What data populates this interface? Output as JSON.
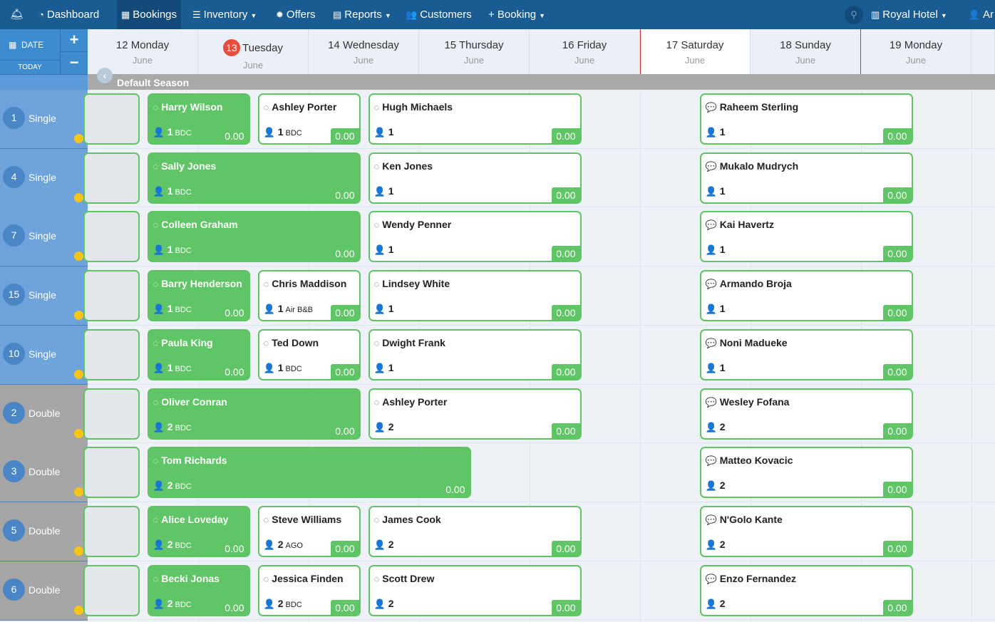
{
  "nav": {
    "items": [
      {
        "label": "Dashboard",
        "icon": "dashboard-icon"
      },
      {
        "label": "Bookings",
        "icon": "grid-icon",
        "active": true
      },
      {
        "label": "Inventory",
        "icon": "database-icon",
        "caret": true
      },
      {
        "label": "Offers",
        "icon": "badge-icon"
      },
      {
        "label": "Reports",
        "icon": "file-icon",
        "caret": true
      },
      {
        "label": "Customers",
        "icon": "users-icon"
      },
      {
        "label": "+ Booking",
        "caret": true
      }
    ],
    "hotel": "Royal Hotel",
    "user": "Ar"
  },
  "controls": {
    "date": "DATE",
    "today": "TODAY",
    "plus": "+",
    "minus": "−"
  },
  "days": [
    {
      "day": "12 Monday",
      "month": "June"
    },
    {
      "day": "Tuesday",
      "month": "June",
      "badge": "13"
    },
    {
      "day": "14 Wednesday",
      "month": "June"
    },
    {
      "day": "15 Thursday",
      "month": "June"
    },
    {
      "day": "16 Friday",
      "month": "June"
    },
    {
      "day": "17 Saturday",
      "month": "June",
      "white": true
    },
    {
      "day": "18 Sunday",
      "month": "June"
    },
    {
      "day": "19 Monday",
      "month": "June"
    },
    {
      "day": "",
      "month": ""
    }
  ],
  "season": "Default Season",
  "rooms": [
    {
      "num": "1",
      "type": "Single",
      "kind": "single"
    },
    {
      "num": "4",
      "type": "Single",
      "kind": "single"
    },
    {
      "num": "7",
      "type": "Single",
      "kind": "single"
    },
    {
      "num": "15",
      "type": "Single",
      "kind": "single"
    },
    {
      "num": "10",
      "type": "Single",
      "kind": "single"
    },
    {
      "num": "2",
      "type": "Double",
      "kind": "double"
    },
    {
      "num": "3",
      "type": "Double",
      "kind": "double"
    },
    {
      "num": "5",
      "type": "Double",
      "kind": "double"
    },
    {
      "num": "6",
      "type": "Double",
      "kind": "double"
    }
  ],
  "bookings": [
    {
      "row": 0,
      "start": -1,
      "end": 0.5,
      "style": "blank"
    },
    {
      "row": 0,
      "start": 0.5,
      "end": 1.5,
      "style": "filled",
      "name": "Harry Wilson",
      "guests": "1",
      "source": "BDC",
      "price": "0.00"
    },
    {
      "row": 0,
      "start": 1.5,
      "end": 2.5,
      "style": "white",
      "name": "Ashley Porter",
      "guests": "1",
      "source": "BDC",
      "price": "0.00"
    },
    {
      "row": 0,
      "start": 2.5,
      "end": 4.5,
      "style": "white",
      "name": "Hugh Michaels",
      "guests": "1",
      "source": "",
      "price": "0.00"
    },
    {
      "row": 0,
      "start": 5.5,
      "end": 7.5,
      "style": "white",
      "multi": true,
      "name": "Raheem Sterling",
      "guests": "1",
      "source": "",
      "price": "0.00"
    },
    {
      "row": 1,
      "start": -1,
      "end": 0.5,
      "style": "blank"
    },
    {
      "row": 1,
      "start": 0.5,
      "end": 2.5,
      "style": "filled",
      "name": "Sally Jones",
      "guests": "1",
      "source": "BDC",
      "price": "0.00"
    },
    {
      "row": 1,
      "start": 2.5,
      "end": 4.5,
      "style": "white",
      "name": "Ken Jones",
      "guests": "1",
      "source": "",
      "price": "0.00"
    },
    {
      "row": 1,
      "start": 5.5,
      "end": 7.5,
      "style": "white",
      "multi": true,
      "name": "Mukalo Mudrych",
      "guests": "1",
      "source": "",
      "price": "0.00"
    },
    {
      "row": 2,
      "start": -1,
      "end": 0.5,
      "style": "blank"
    },
    {
      "row": 2,
      "start": 0.5,
      "end": 2.5,
      "style": "filled",
      "name": "Colleen Graham",
      "guests": "1",
      "source": "BDC",
      "price": "0.00"
    },
    {
      "row": 2,
      "start": 2.5,
      "end": 4.5,
      "style": "white",
      "name": "Wendy Penner",
      "guests": "1",
      "source": "",
      "price": "0.00"
    },
    {
      "row": 2,
      "start": 5.5,
      "end": 7.5,
      "style": "white",
      "multi": true,
      "name": "Kai Havertz",
      "guests": "1",
      "source": "",
      "price": "0.00"
    },
    {
      "row": 3,
      "start": -1,
      "end": 0.5,
      "style": "blank"
    },
    {
      "row": 3,
      "start": 0.5,
      "end": 1.5,
      "style": "filled",
      "name": "Barry Henderson",
      "guests": "1",
      "source": "BDC",
      "price": "0.00"
    },
    {
      "row": 3,
      "start": 1.5,
      "end": 2.5,
      "style": "white",
      "name": "Chris Maddison",
      "guests": "1",
      "source": "Air B&B",
      "price": "0.00"
    },
    {
      "row": 3,
      "start": 2.5,
      "end": 4.5,
      "style": "white",
      "name": "Lindsey White",
      "guests": "1",
      "source": "",
      "price": "0.00"
    },
    {
      "row": 3,
      "start": 5.5,
      "end": 7.5,
      "style": "white",
      "multi": true,
      "name": "Armando Broja",
      "guests": "1",
      "source": "",
      "price": "0.00"
    },
    {
      "row": 4,
      "start": -1,
      "end": 0.5,
      "style": "blank"
    },
    {
      "row": 4,
      "start": 0.5,
      "end": 1.5,
      "style": "filled",
      "name": "Paula King",
      "guests": "1",
      "source": "BDC",
      "price": "0.00"
    },
    {
      "row": 4,
      "start": 1.5,
      "end": 2.5,
      "style": "white",
      "name": "Ted Down",
      "guests": "1",
      "source": "BDC",
      "price": "0.00"
    },
    {
      "row": 4,
      "start": 2.5,
      "end": 4.5,
      "style": "white",
      "name": "Dwight Frank",
      "guests": "1",
      "source": "",
      "price": "0.00"
    },
    {
      "row": 4,
      "start": 5.5,
      "end": 7.5,
      "style": "white",
      "multi": true,
      "name": "Noni Madueke",
      "guests": "1",
      "source": "",
      "price": "0.00"
    },
    {
      "row": 5,
      "start": -1,
      "end": 0.5,
      "style": "blank"
    },
    {
      "row": 5,
      "start": 0.5,
      "end": 2.5,
      "style": "filled",
      "name": "Oliver Conran",
      "guests": "2",
      "source": "BDC",
      "price": "0.00"
    },
    {
      "row": 5,
      "start": 2.5,
      "end": 4.5,
      "style": "white",
      "name": "Ashley Porter",
      "guests": "2",
      "source": "",
      "price": "0.00"
    },
    {
      "row": 5,
      "start": 5.5,
      "end": 7.5,
      "style": "white",
      "multi": true,
      "name": "Wesley Fofana",
      "guests": "2",
      "source": "",
      "price": "0.00"
    },
    {
      "row": 6,
      "start": -1,
      "end": 0.5,
      "style": "blank"
    },
    {
      "row": 6,
      "start": 0.5,
      "end": 3.5,
      "style": "filled",
      "name": "Tom Richards",
      "guests": "2",
      "source": "BDC",
      "price": "0.00"
    },
    {
      "row": 6,
      "start": 5.5,
      "end": 7.5,
      "style": "white",
      "multi": true,
      "name": "Matteo Kovacic",
      "guests": "2",
      "source": "",
      "price": "0.00"
    },
    {
      "row": 7,
      "start": -1,
      "end": 0.5,
      "style": "blank"
    },
    {
      "row": 7,
      "start": 0.5,
      "end": 1.5,
      "style": "filled",
      "name": "Alice Loveday",
      "guests": "2",
      "source": "BDC",
      "price": "0.00"
    },
    {
      "row": 7,
      "start": 1.5,
      "end": 2.5,
      "style": "white",
      "name": "Steve Williams",
      "guests": "2",
      "source": "AGO",
      "price": "0.00"
    },
    {
      "row": 7,
      "start": 2.5,
      "end": 4.5,
      "style": "white",
      "name": "James Cook",
      "guests": "2",
      "source": "",
      "price": "0.00"
    },
    {
      "row": 7,
      "start": 5.5,
      "end": 7.5,
      "style": "white",
      "multi": true,
      "name": "N'Golo Kante",
      "guests": "2",
      "source": "",
      "price": "0.00"
    },
    {
      "row": 8,
      "start": -1,
      "end": 0.5,
      "style": "blank"
    },
    {
      "row": 8,
      "start": 0.5,
      "end": 1.5,
      "style": "filled",
      "name": "Becki Jonas",
      "guests": "2",
      "source": "BDC",
      "price": "0.00"
    },
    {
      "row": 8,
      "start": 1.5,
      "end": 2.5,
      "style": "white",
      "name": "Jessica Finden",
      "guests": "2",
      "source": "BDC",
      "price": "0.00"
    },
    {
      "row": 8,
      "start": 2.5,
      "end": 4.5,
      "style": "white",
      "name": "Scott Drew",
      "guests": "2",
      "source": "",
      "price": "0.00"
    },
    {
      "row": 8,
      "start": 5.5,
      "end": 7.5,
      "style": "white",
      "multi": true,
      "name": "Enzo Fernandez",
      "guests": "2",
      "source": "",
      "price": "0.00"
    }
  ]
}
